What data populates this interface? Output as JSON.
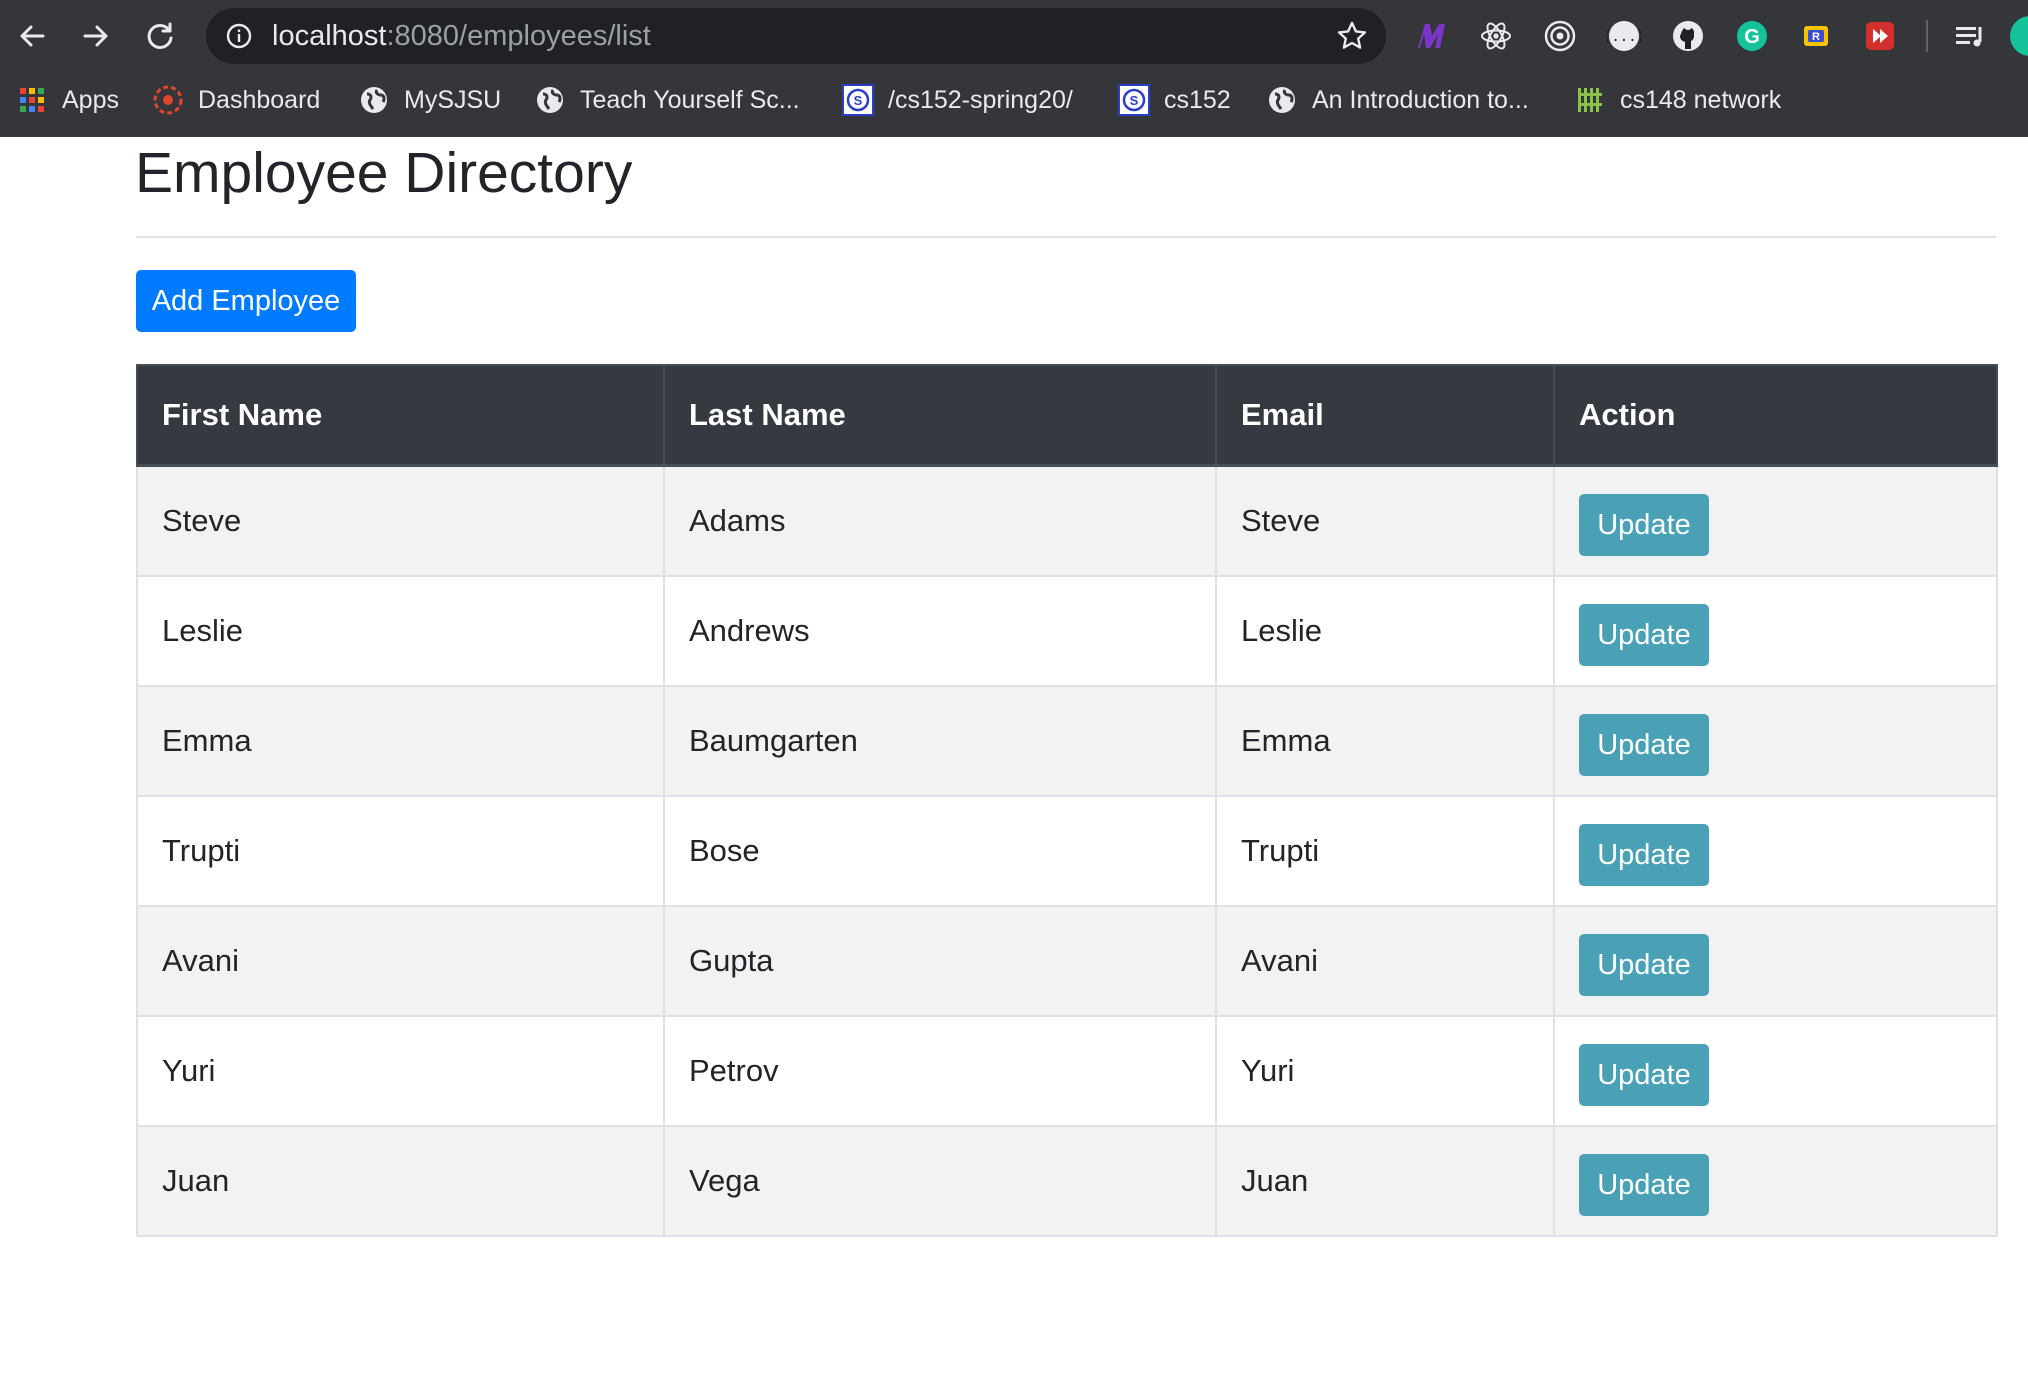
{
  "browser": {
    "url_host": "localhost",
    "url_path": ":8080/employees/list",
    "bookmarks": [
      {
        "label": "Apps",
        "icon": "apps-grid-icon"
      },
      {
        "label": "Dashboard",
        "icon": "dashboard-icon"
      },
      {
        "label": "MySJSU",
        "icon": "globe-icon"
      },
      {
        "label": "Teach Yourself Sc...",
        "icon": "globe-icon"
      },
      {
        "label": "/cs152-spring20/",
        "icon": "site-favicon-icon"
      },
      {
        "label": "cs152",
        "icon": "site-favicon-icon"
      },
      {
        "label": "An Introduction to...",
        "icon": "globe-icon"
      },
      {
        "label": "cs148 network",
        "icon": "network-grid-icon"
      }
    ],
    "extensions": [
      "m-extension-icon",
      "react-devtools-icon",
      "target-icon",
      "json-viewer-icon",
      "github-icon",
      "grammarly-icon",
      "redux-icon",
      "video-skip-icon",
      "reading-list-icon"
    ],
    "colors": {
      "chrome": "#35363a",
      "omnibox": "#202124"
    }
  },
  "page": {
    "title": "Employee Directory",
    "add_button": "Add Employee",
    "colors": {
      "primary": "#007bff",
      "info": "#4aa0b5",
      "table_header": "#343a40",
      "stripe": "#f2f2f2"
    }
  },
  "table": {
    "headers": [
      "First Name",
      "Last Name",
      "Email",
      "Action"
    ],
    "rows": [
      {
        "first": "Steve",
        "last": "Adams",
        "email": "Steve",
        "action": "Update"
      },
      {
        "first": "Leslie",
        "last": "Andrews",
        "email": "Leslie",
        "action": "Update"
      },
      {
        "first": "Emma",
        "last": "Baumgarten",
        "email": "Emma",
        "action": "Update"
      },
      {
        "first": "Trupti",
        "last": "Bose",
        "email": "Trupti",
        "action": "Update"
      },
      {
        "first": "Avani",
        "last": "Gupta",
        "email": "Avani",
        "action": "Update"
      },
      {
        "first": "Yuri",
        "last": "Petrov",
        "email": "Yuri",
        "action": "Update"
      },
      {
        "first": "Juan",
        "last": "Vega",
        "email": "Juan",
        "action": "Update"
      }
    ]
  }
}
